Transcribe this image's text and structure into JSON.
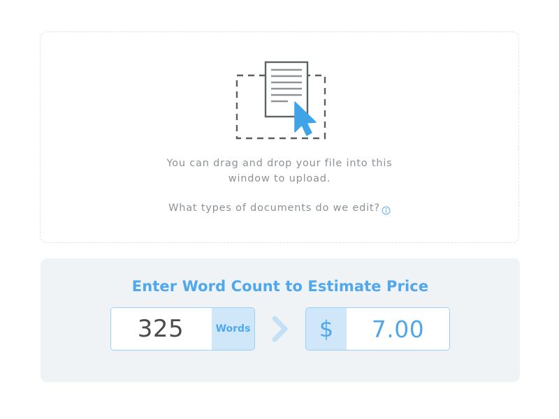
{
  "dropzone": {
    "icon_name": "document-drag-drop-icon",
    "instruction_line1": "You can drag and drop your file into this",
    "instruction_line2": "window to upload.",
    "help_link_text": "What types of documents do we edit?",
    "help_icon_name": "info-circle-icon",
    "border_color": "#e1e4e8",
    "text_color": "#8c9196"
  },
  "estimator": {
    "title": "Enter Word Count to Estimate Price",
    "title_color": "#4fa8ec",
    "panel_bg": "#eff3f6",
    "word_input": {
      "value": "325",
      "placeholder": "325",
      "suffix_label": "Words",
      "suffix_bg": "#cfe7f8",
      "suffix_text_color": "#50a9ef",
      "border_color": "#9ed0f2"
    },
    "separator_icon": "chevron-right-icon",
    "separator_color": "#c3e0f5",
    "price_output": {
      "currency_symbol": "$",
      "value": "7.00",
      "symbol_bg": "#cfe7f8",
      "text_color": "#4fa6ea",
      "border_color": "#9ed0f2"
    }
  }
}
